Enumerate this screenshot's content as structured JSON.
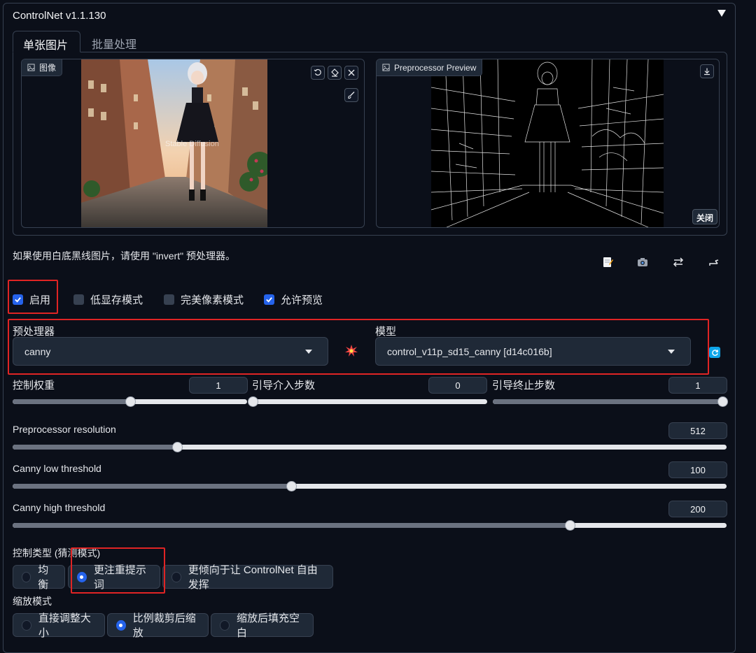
{
  "header": {
    "title": "ControlNet v1.1.130"
  },
  "tabs": [
    {
      "label": "单张图片"
    },
    {
      "label": "批量处理"
    }
  ],
  "image_box": {
    "label": "图像",
    "overlay_text": "Stable Diffusion"
  },
  "preview_box": {
    "label": "Preprocessor Preview",
    "close_label": "关闭"
  },
  "hint": "如果使用白底黑线图片，请使用 \"invert\" 预处理器。",
  "checkboxes": [
    {
      "label": "启用",
      "checked": true
    },
    {
      "label": "低显存模式",
      "checked": false
    },
    {
      "label": "完美像素模式",
      "checked": false
    },
    {
      "label": "允许预览",
      "checked": true
    }
  ],
  "preprocessor": {
    "label": "预处理器",
    "value": "canny"
  },
  "model": {
    "label": "模型",
    "value": "control_v11p_sd15_canny [d14c016b]"
  },
  "sliders": {
    "weight": {
      "label": "控制权重",
      "value": "1",
      "fraction": 0.5
    },
    "start": {
      "label": "引导介入步数",
      "value": "0",
      "fraction": 0.0
    },
    "end": {
      "label": "引导终止步数",
      "value": "1",
      "fraction": 1.0
    },
    "resolution": {
      "label": "Preprocessor resolution",
      "value": "512",
      "fraction": 0.23
    },
    "low": {
      "label": "Canny low threshold",
      "value": "100",
      "fraction": 0.39
    },
    "high": {
      "label": "Canny high threshold",
      "value": "200",
      "fraction": 0.78
    }
  },
  "control_mode": {
    "label": "控制类型 (猜测模式)",
    "options": [
      {
        "label": "均衡",
        "selected": false
      },
      {
        "label": "更注重提示词",
        "selected": true
      },
      {
        "label": "更倾向于让 ControlNet 自由发挥",
        "selected": false
      }
    ]
  },
  "resize_mode": {
    "label": "缩放模式",
    "options": [
      {
        "label": "直接调整大小",
        "selected": false
      },
      {
        "label": "比例裁剪后缩放",
        "selected": true
      },
      {
        "label": "缩放后填充空白",
        "selected": false
      }
    ]
  },
  "colors": {
    "accent": "#2563eb",
    "highlight": "#e02424",
    "background": "#0b0f19"
  }
}
